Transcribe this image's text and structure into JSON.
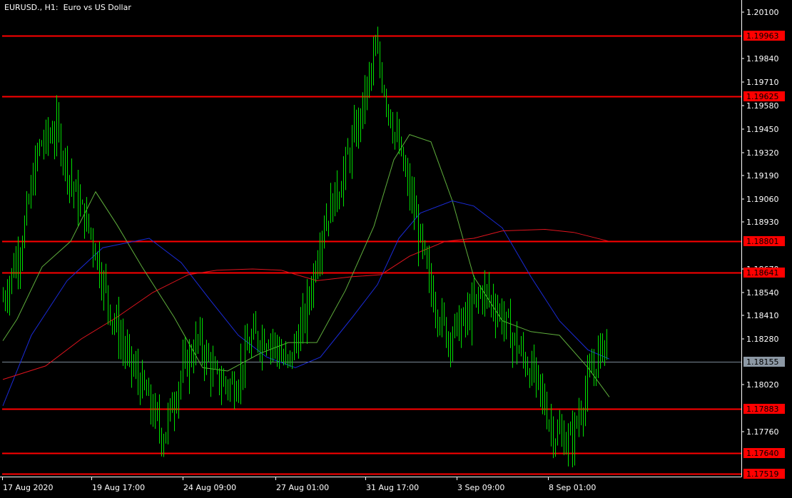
{
  "chart_data": {
    "type": "candlestick",
    "title": "EURUSD., H1:  Euro vs US Dollar",
    "symbol": "EURUSD.",
    "timeframe": "H1",
    "description": "Euro vs US Dollar",
    "colors": {
      "background": "#000000",
      "axis": "#ffffff",
      "candles": "#00e000",
      "level_lines": "#ff0000",
      "current_price_line": "#7a8896",
      "current_price_label_bg": "#8c98a4",
      "ma_fast": "#5fae3c",
      "ma_medium": "#1a2bd9",
      "ma_slow": "#e0141e"
    },
    "ylim": [
      1.1747,
      1.2019
    ],
    "y_ticks": [
      "1.20100",
      "1.19840",
      "1.19710",
      "1.19580",
      "1.19450",
      "1.19320",
      "1.19190",
      "1.19060",
      "1.18930",
      "1.18670",
      "1.18540",
      "1.18410",
      "1.18280",
      "1.18020",
      "1.17760"
    ],
    "x_ticks": [
      "17 Aug 2020",
      "19 Aug 17:00",
      "24 Aug 09:00",
      "27 Aug 01:00",
      "31 Aug 17:00",
      "3 Sep 09:00",
      "8 Sep 01:00"
    ],
    "levels": [
      "1.19963",
      "1.19625",
      "1.18801",
      "1.18641",
      "1.17883",
      "1.17640",
      "1.17519"
    ],
    "current_price": "1.18155",
    "series_points": [
      [
        1.1845,
        1.1855
      ],
      [
        1.1878,
        1.188
      ],
      [
        1.195,
        1.192
      ],
      [
        1.1955,
        1.1935
      ],
      [
        1.192,
        1.19
      ],
      [
        1.1888,
        1.188
      ],
      [
        1.185,
        1.184
      ],
      [
        1.182,
        1.1815
      ],
      [
        1.1795,
        1.18
      ],
      [
        1.1775,
        1.177
      ],
      [
        1.18,
        1.1815
      ],
      [
        1.1835,
        1.182
      ],
      [
        1.181,
        1.18
      ],
      [
        1.1797,
        1.1805
      ],
      [
        1.1825,
        1.183
      ],
      [
        1.1835,
        1.1825
      ],
      [
        1.1815,
        1.181
      ],
      [
        1.183,
        1.185
      ],
      [
        1.188,
        1.19
      ],
      [
        1.1905,
        1.1925
      ],
      [
        1.1945,
        1.195
      ],
      [
        1.199,
        1.1985
      ],
      [
        1.196,
        1.193
      ],
      [
        1.191,
        1.19
      ],
      [
        1.187,
        1.1845
      ],
      [
        1.1835,
        1.1825
      ],
      [
        1.183,
        1.1845
      ],
      [
        1.186,
        1.185
      ],
      [
        1.1845,
        1.184
      ],
      [
        1.1825,
        1.182
      ],
      [
        1.181,
        1.18
      ],
      [
        1.178,
        1.177
      ],
      [
        1.1765,
        1.1775
      ],
      [
        1.179,
        1.182
      ],
      [
        1.183,
        1.183
      ]
    ],
    "moving_averages": [
      {
        "values": [
          [
            0,
            1.1827
          ],
          [
            20,
            1.1839
          ],
          [
            55,
            1.1868
          ],
          [
            95,
            1.188
          ],
          [
            130,
            1.191
          ],
          [
            160,
            1.1891
          ],
          [
            195,
            1.1868
          ],
          [
            240,
            1.184
          ],
          [
            280,
            1.1812
          ],
          [
            315,
            1.181
          ],
          [
            360,
            1.182
          ],
          [
            400,
            1.1826
          ],
          [
            440,
            1.1826
          ],
          [
            480,
            1.1855
          ],
          [
            520,
            1.189
          ],
          [
            548,
            1.1928
          ],
          [
            570,
            1.1942
          ],
          [
            600,
            1.1938
          ],
          [
            630,
            1.1905
          ],
          [
            660,
            1.1862
          ],
          [
            700,
            1.1838
          ],
          [
            740,
            1.1832
          ],
          [
            780,
            1.183
          ],
          [
            820,
            1.1812
          ],
          [
            850,
            1.1795
          ]
        ]
      },
      {
        "values": [
          [
            0,
            1.179
          ],
          [
            40,
            1.183
          ],
          [
            90,
            1.186
          ],
          [
            140,
            1.1877
          ],
          [
            205,
            1.1882
          ],
          [
            250,
            1.187
          ],
          [
            290,
            1.185
          ],
          [
            330,
            1.183
          ],
          [
            370,
            1.1818
          ],
          [
            410,
            1.1812
          ],
          [
            445,
            1.1818
          ],
          [
            490,
            1.184
          ],
          [
            525,
            1.1858
          ],
          [
            555,
            1.1882
          ],
          [
            585,
            1.1898
          ],
          [
            630,
            1.1905
          ],
          [
            660,
            1.1902
          ],
          [
            700,
            1.1889
          ],
          [
            740,
            1.1862
          ],
          [
            780,
            1.1838
          ],
          [
            820,
            1.1822
          ],
          [
            850,
            1.1817
          ]
        ]
      },
      {
        "values": [
          [
            0,
            1.1805
          ],
          [
            60,
            1.1813
          ],
          [
            110,
            1.1828
          ],
          [
            160,
            1.184
          ],
          [
            210,
            1.1854
          ],
          [
            260,
            1.1863
          ],
          [
            300,
            1.1866
          ],
          [
            350,
            1.1867
          ],
          [
            390,
            1.1866
          ],
          [
            440,
            1.186
          ],
          [
            490,
            1.1862
          ],
          [
            530,
            1.1863
          ],
          [
            570,
            1.1873
          ],
          [
            620,
            1.188
          ],
          [
            660,
            1.1882
          ],
          [
            700,
            1.1887
          ],
          [
            760,
            1.1888
          ],
          [
            800,
            1.1886
          ],
          [
            850,
            1.188
          ]
        ]
      }
    ]
  }
}
